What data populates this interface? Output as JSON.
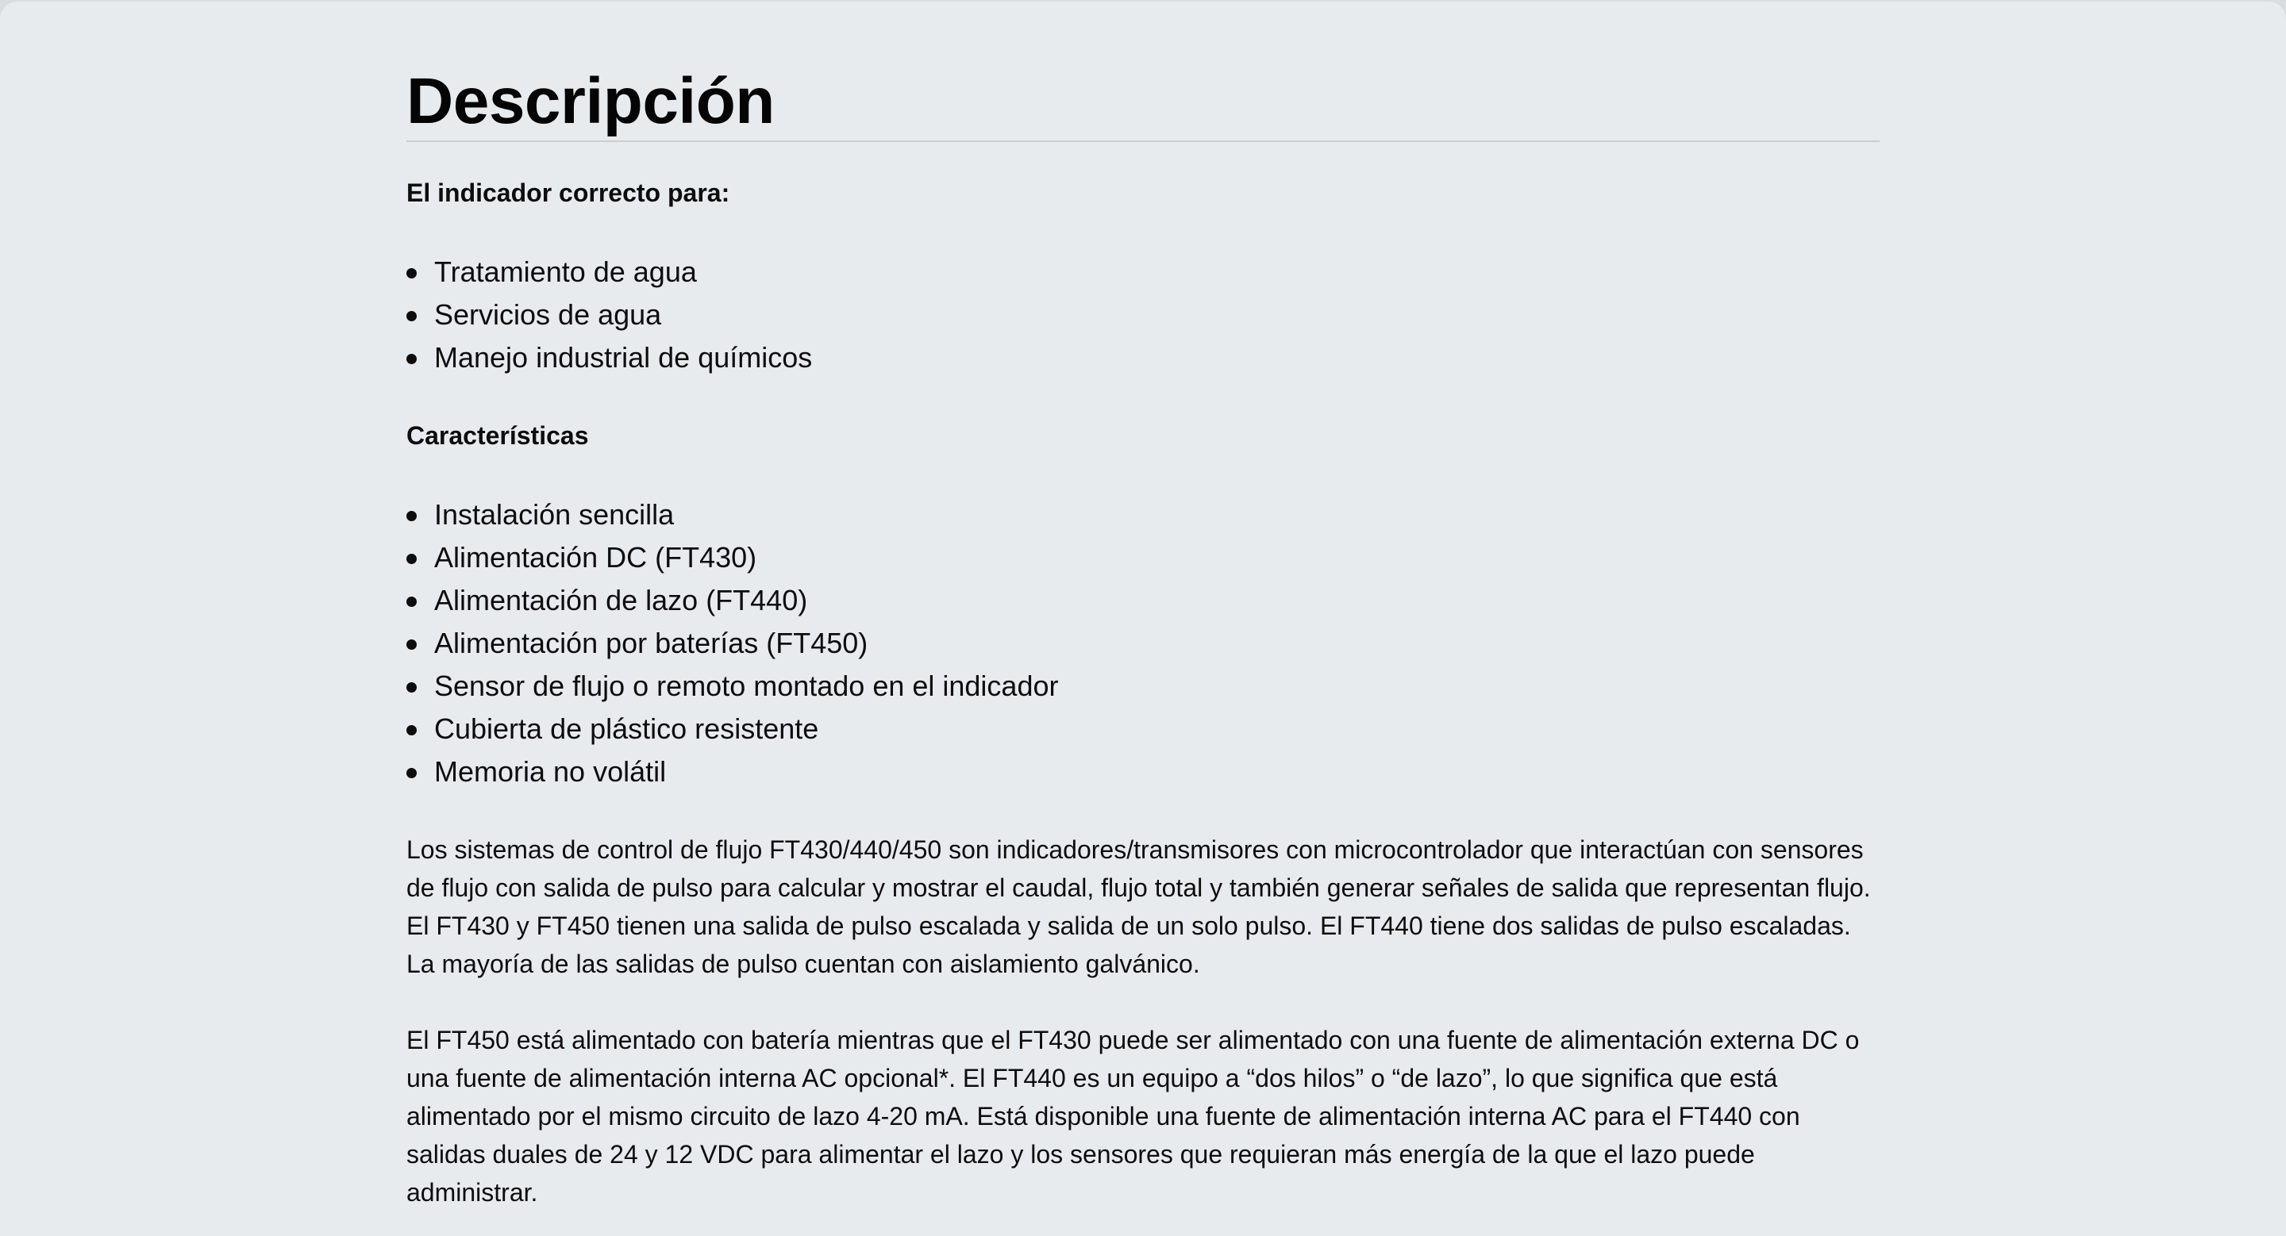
{
  "title": "Descripción",
  "section1": {
    "heading": "El indicador correcto para:",
    "items": [
      "Tratamiento de agua",
      "Servicios de agua",
      "Manejo industrial de químicos"
    ]
  },
  "section2": {
    "heading": "Características",
    "items": [
      "Instalación sencilla",
      "Alimentación DC (FT430)",
      "Alimentación de lazo (FT440)",
      "Alimentación por baterías (FT450)",
      "Sensor de flujo o remoto montado en el indicador",
      "Cubierta de plástico resistente",
      "Memoria no volátil"
    ]
  },
  "paragraphs": [
    "Los sistemas de control de flujo FT430/440/450 son indicadores/transmisores con microcontrolador que interactúan con sensores de flujo con salida de pulso para calcular y mostrar el caudal, flujo total y también generar señales de salida que representan flujo. El FT430 y FT450 tienen una salida de pulso escalada y salida de un solo pulso. El FT440 tiene dos salidas de pulso escaladas. La mayoría de las salidas de pulso cuentan con aislamiento galvánico.",
    "El FT450 está alimentado con batería mientras que el FT430 puede ser alimentado con una fuente de alimentación externa DC o una fuente de alimentación interna AC opcional*. El FT440 es un equipo a “dos hilos” o “de lazo”, lo que significa que está alimentado por el mismo circuito de lazo 4-20 mA. Está disponible una fuente de alimentación interna AC para el FT440 con salidas duales de 24 y 12 VDC para alimentar el lazo y los sensores que requieran más energía de la que el lazo puede administrar."
  ]
}
